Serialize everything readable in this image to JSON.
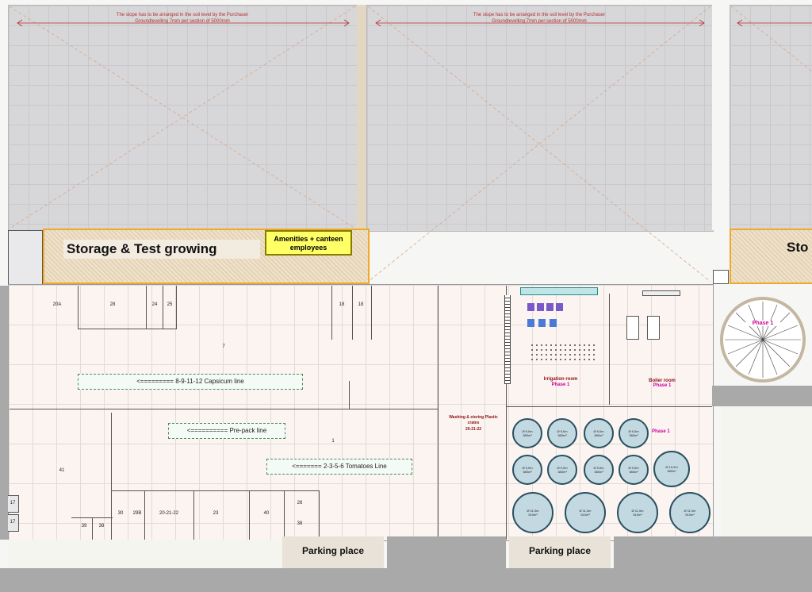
{
  "greenhouse": {
    "slope_note": "The slope has to be arranged in the soil level by the Purchaser",
    "levelling_note": "Groundlevelling 7mm per section of 5000mm"
  },
  "labels": {
    "storage": "Storage & Test growing",
    "storage_cut": "Sto",
    "amenities": "Amenities + canteen employees",
    "capsicum_line": "<========= 8-9-11-12 Capsicum line",
    "prepack_line": "<========== Pre-pack line",
    "tomatoes_line": "<======= 2-3-5-6 Tomatoes Line",
    "parking_left": "Parking place",
    "parking_right": "Parking place",
    "silo_phase": "Phase 1",
    "irrigation_room": "Irrigation room",
    "irrigation_phase": "Phase 1",
    "boiler_room": "Boiler room",
    "boiler_phase": "Phase 1",
    "tanks_phase": "Phase 1",
    "washing": "Washing & storing Plastic crates",
    "washing_num": "20-21-22"
  },
  "rooms": {
    "r20a": "20A",
    "r28": "28",
    "r24": "24",
    "r25": "25",
    "r18a": "18",
    "r18b": "18",
    "r7": "7",
    "r1": "1",
    "r41": "41",
    "r30": "30",
    "r29b": "29B",
    "r20_21_22": "20-21-22",
    "r23": "23",
    "r40": "40",
    "r26": "26",
    "r38": "38",
    "r39": "39",
    "r38b": "38",
    "r17a": "17",
    "r17b": "17"
  },
  "tanks": [
    {
      "d": "Ø 9,0m",
      "v": "380m³"
    },
    {
      "d": "Ø 9,0m",
      "v": "380m³"
    },
    {
      "d": "Ø 9,0m",
      "v": "380m³"
    },
    {
      "d": "Ø 9,0m",
      "v": "380m³"
    },
    {
      "d": "Ø 9,0m",
      "v": "380m³"
    },
    {
      "d": "Ø 9,0m",
      "v": "380m³"
    },
    {
      "d": "Ø 9,0m",
      "v": "380m³"
    },
    {
      "d": "Ø 9,0m",
      "v": "380m³"
    },
    {
      "d": "Ø 10,2m",
      "v": "380m³"
    },
    {
      "d": "Ø 11,0m",
      "v": "510m³"
    },
    {
      "d": "Ø 11,0m",
      "v": "510m³"
    },
    {
      "d": "Ø 11,0m",
      "v": "510m³"
    },
    {
      "d": "Ø 11,0m",
      "v": "510m³"
    }
  ],
  "colors": {
    "storage_border": "#f0a826",
    "amenities_fill": "#ffff66",
    "tank_fill": "#c2d9e2",
    "phase_text": "#d000a0",
    "slope_text": "#b33030"
  }
}
